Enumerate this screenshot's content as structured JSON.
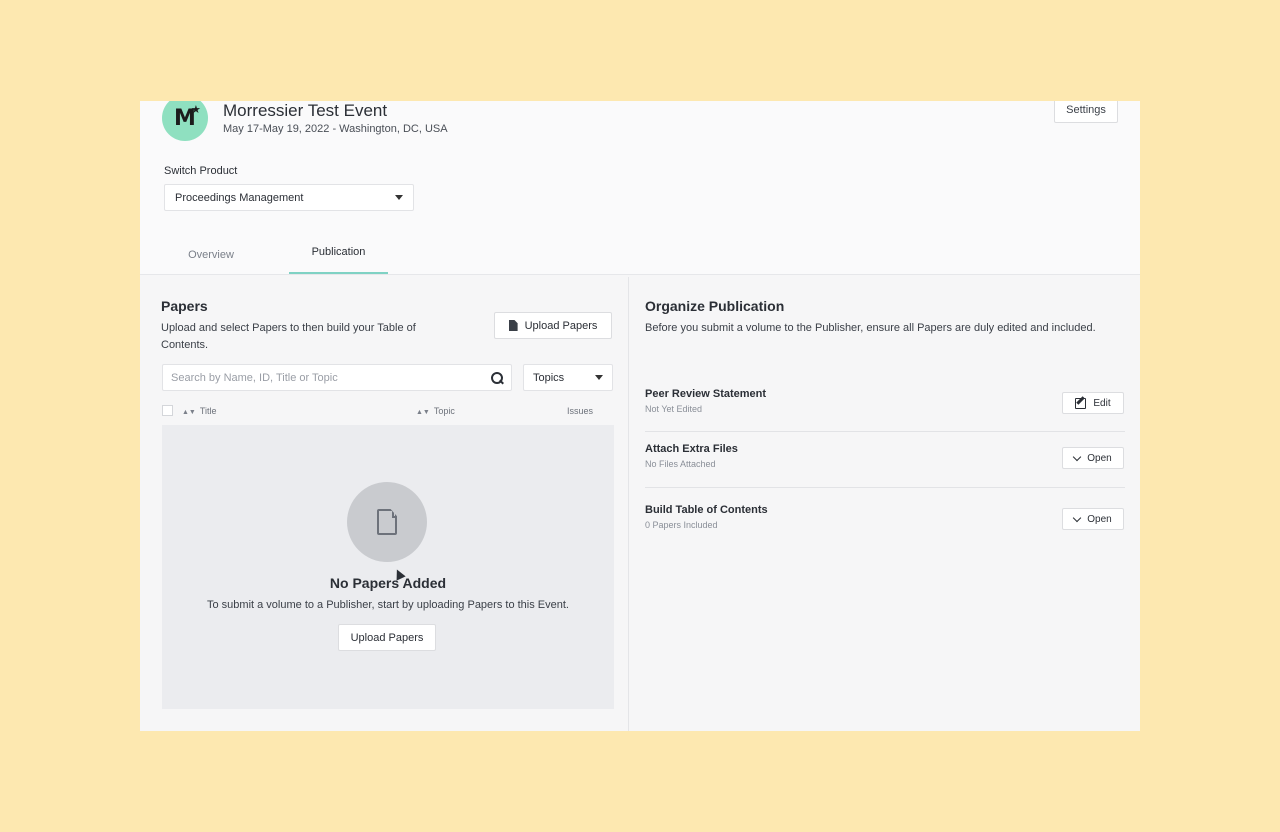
{
  "event": {
    "title": "Morressier Test Event",
    "subtitle": "May 17-May 19, 2022 - Washington, DC, USA",
    "logo_letter": "M",
    "logo_star": "★",
    "brand_color": "#8fe0c0"
  },
  "header": {
    "settings_label": "Settings"
  },
  "switch_product": {
    "label": "Switch Product",
    "selected": "Proceedings Management"
  },
  "tabs": [
    {
      "label": "Overview",
      "active": false
    },
    {
      "label": "Publication",
      "active": true
    }
  ],
  "papers": {
    "title": "Papers",
    "description": "Upload and select Papers to then build your Table of Contents.",
    "upload_label": "Upload Papers",
    "search_placeholder": "Search by Name, ID, Title or Topic",
    "topics_label": "Topics",
    "columns": [
      "Title",
      "Topic",
      "Issues"
    ],
    "empty_title": "No Papers Added",
    "empty_desc": "To submit a volume to a Publisher, start by uploading Papers to this Event.",
    "empty_upload_label": "Upload Papers"
  },
  "organize": {
    "title": "Organize Publication",
    "description": "Before you submit a volume to the Publisher, ensure all Papers are duly edited and included.",
    "items": [
      {
        "name": "Peer Review Statement",
        "status": "Not Yet Edited",
        "action": "Edit",
        "icon": "edit-icon"
      },
      {
        "name": "Attach Extra Files",
        "status": "No Files Attached",
        "action": "Open",
        "icon": "chevron-down-icon"
      },
      {
        "name": "Build Table of Contents",
        "status": "0 Papers Included",
        "action": "Open",
        "icon": "chevron-down-icon"
      }
    ]
  },
  "colors": {
    "tab_accent": "#7fd2c4",
    "background": "#fde8b0"
  }
}
